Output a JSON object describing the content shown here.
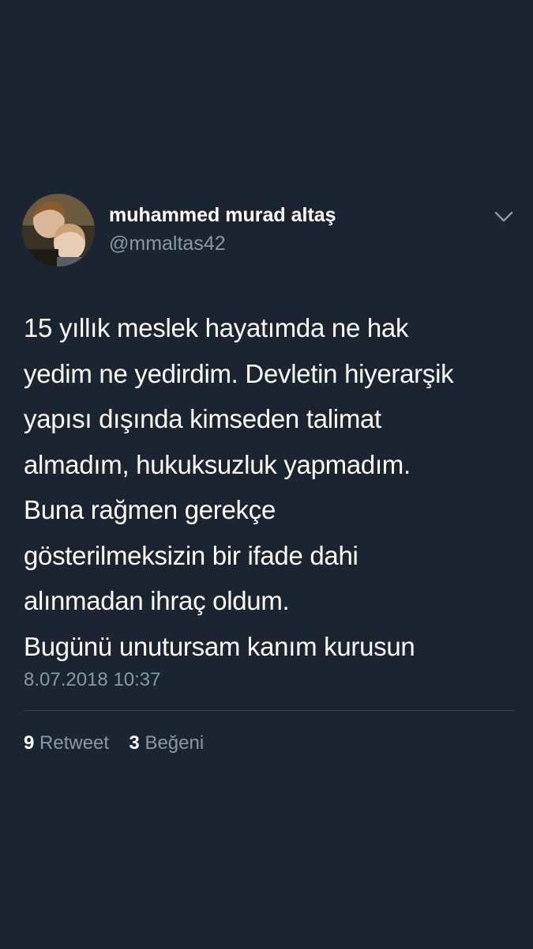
{
  "tweet": {
    "author": {
      "display_name": "muhammed murad altaş",
      "handle": "@mmaltas42",
      "avatar_icon": "profile-photo-avatar"
    },
    "menu_icon": "chevron-down-icon",
    "text_lines": [
      "15 yıllık meslek hayatımda ne hak",
      "yedim ne yedirdim. Devletin hiyerarşik",
      "yapısı dışında kimseden talimat",
      "almadım, hukuksuzluk yapmadım.",
      "Buna rağmen gerekçe",
      "gösterilmeksizin bir ifade dahi",
      "alınmadan ihraç oldum.",
      "Bugünü unutursam kanım kurusun"
    ],
    "timestamp": "8.07.2018 10:37",
    "stats": {
      "retweet_count": "9",
      "retweet_label": "Retweet",
      "like_count": "3",
      "like_label": "Beğeni"
    }
  },
  "colors": {
    "background": "#1b2531",
    "primary_text": "#ffffff",
    "secondary_text": "#8899a6",
    "divider": "#38444d"
  }
}
